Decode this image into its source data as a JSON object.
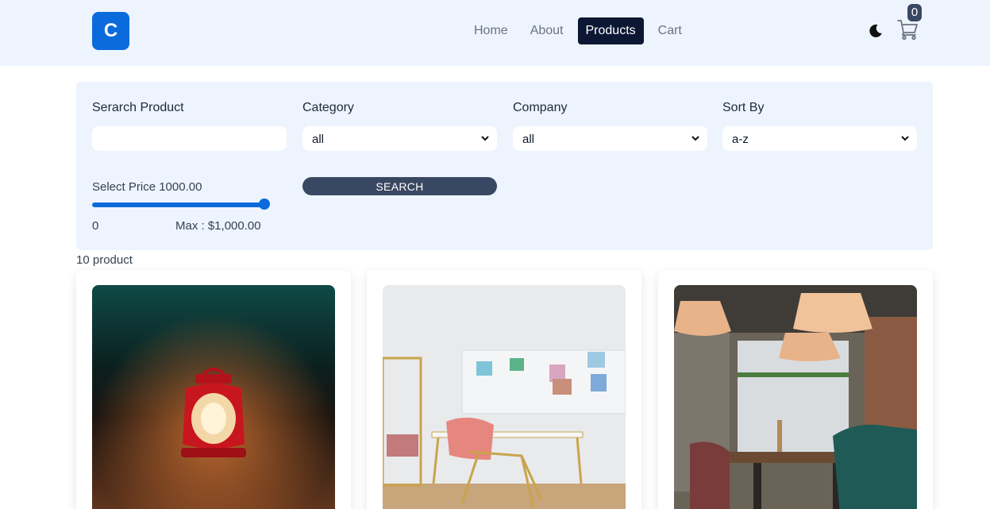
{
  "nav": {
    "logo": "C",
    "links": [
      "Home",
      "About",
      "Products",
      "Cart"
    ],
    "active": "Products",
    "cart_count": "0",
    "icons": [
      "moon-icon",
      "cart-icon"
    ]
  },
  "filters": {
    "search_label": "Serarch Product",
    "search_value": "",
    "category_label": "Category",
    "category_value": "all",
    "company_label": "Company",
    "company_value": "all",
    "sort_label": "Sort By",
    "sort_value": "a-z",
    "price_label": "Select Price 1000.00",
    "price_min": "0",
    "price_max": "Max : $1,000.00",
    "price_level": 1.0,
    "search_button": "SEARCH"
  },
  "results": {
    "count_text": "10 product"
  },
  "colors": {
    "brand": "#0b6bdc",
    "nav_bg": "#eef4fd",
    "active_nav": "#0b1733",
    "button": "#394862"
  }
}
